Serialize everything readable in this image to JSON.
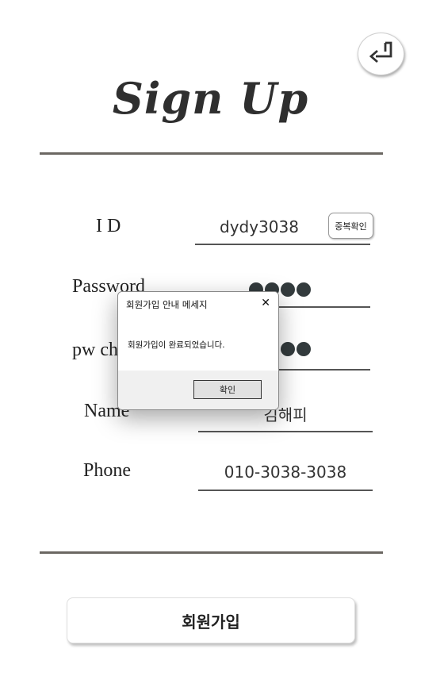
{
  "header": {
    "title": "Sign Up",
    "back_icon": "return-arrow-icon"
  },
  "form": {
    "id": {
      "label": "I D",
      "value": "dydy3038",
      "check_button": "중복확인"
    },
    "password": {
      "label": "Password",
      "masked_length": 4
    },
    "pw_check": {
      "label": "pw check",
      "masked_length": 4
    },
    "name": {
      "label": "Name",
      "value": "김해피"
    },
    "phone": {
      "label": "Phone",
      "value": "010-3038-3038"
    }
  },
  "footer": {
    "signup_button": "회원가입"
  },
  "dialog": {
    "title": "회원가입 안내 메세지",
    "close_icon": "close-icon",
    "message": "회원가입이 완료되었습니다.",
    "ok_button": "확인"
  }
}
